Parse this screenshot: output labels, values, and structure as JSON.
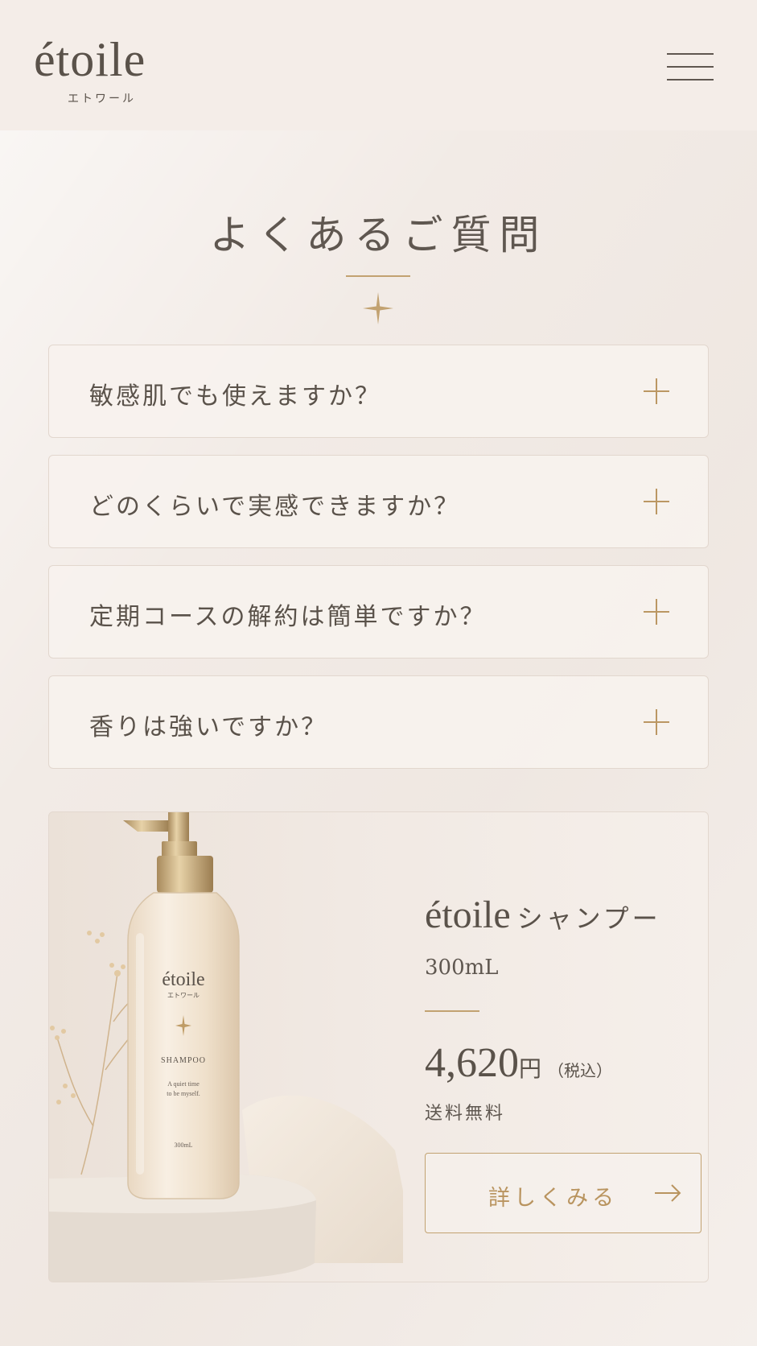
{
  "header": {
    "logo_main": "étoile",
    "logo_sub": "エトワール",
    "menu_icon": "hamburger-menu-icon"
  },
  "faq": {
    "title": "よくあるご質問",
    "items": [
      {
        "question": "敏感肌でも使えますか？"
      },
      {
        "question": "どのくらいで実感できますか？"
      },
      {
        "question": "定期コースの解約は簡単ですか？"
      },
      {
        "question": "香りは強いですか？"
      }
    ]
  },
  "product": {
    "brand": "étoile",
    "name": "シャンプー",
    "volume": "300mL",
    "price": "4,620",
    "currency": "円",
    "tax_note": "（税込）",
    "shipping": "送料無料",
    "button_label": "詳しくみる",
    "bottle_label": {
      "brand": "étoile",
      "brand_sub": "エトワール",
      "type": "SHAMPOO",
      "tagline_1": "A quiet time",
      "tagline_2": "to be myself.",
      "volume": "300mL"
    }
  },
  "colors": {
    "background": "#f2ebe6",
    "text": "#5f5750",
    "accent_gold": "#c2a271"
  }
}
